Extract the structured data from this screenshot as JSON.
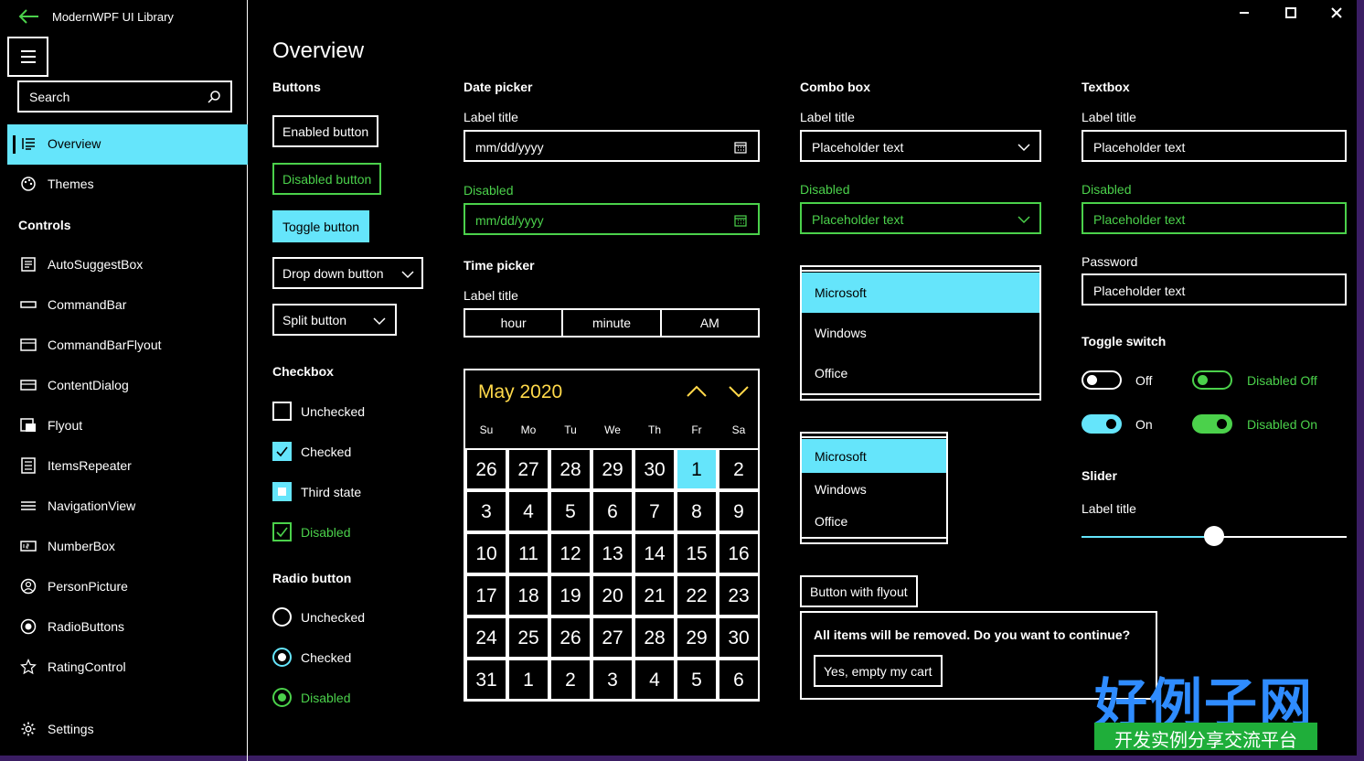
{
  "app": {
    "title": "ModernWPF UI Library"
  },
  "sidebar": {
    "search_placeholder": "Search",
    "items": [
      {
        "label": "Overview",
        "icon": "list-icon",
        "selected": true
      },
      {
        "label": "Themes",
        "icon": "palette-icon"
      }
    ],
    "controls_header": "Controls",
    "controls": [
      {
        "label": "AutoSuggestBox",
        "icon": "autosuggest-icon"
      },
      {
        "label": "CommandBar",
        "icon": "commandbar-icon"
      },
      {
        "label": "CommandBarFlyout",
        "icon": "commandbarflyout-icon"
      },
      {
        "label": "ContentDialog",
        "icon": "contentdialog-icon"
      },
      {
        "label": "Flyout",
        "icon": "flyout-icon"
      },
      {
        "label": "ItemsRepeater",
        "icon": "itemsrepeater-icon"
      },
      {
        "label": "NavigationView",
        "icon": "navigationview-icon"
      },
      {
        "label": "NumberBox",
        "icon": "numberbox-icon"
      },
      {
        "label": "PersonPicture",
        "icon": "personpicture-icon"
      },
      {
        "label": "RadioButtons",
        "icon": "radiobuttons-icon"
      },
      {
        "label": "RatingControl",
        "icon": "star-icon"
      }
    ],
    "settings_label": "Settings"
  },
  "page": {
    "title": "Overview"
  },
  "buttons": {
    "header": "Buttons",
    "enabled": "Enabled button",
    "disabled": "Disabled button",
    "toggle": "Toggle button",
    "dropdown": "Drop down button",
    "split": "Split button"
  },
  "checkbox": {
    "header": "Checkbox",
    "unchecked": "Unchecked",
    "checked": "Checked",
    "third": "Third state",
    "disabled": "Disabled"
  },
  "radio": {
    "header": "Radio button",
    "unchecked": "Unchecked",
    "checked": "Checked",
    "disabled": "Disabled"
  },
  "datepicker": {
    "header": "Date picker",
    "label": "Label title",
    "value": "mm/dd/yyyy",
    "disabled_label": "Disabled",
    "disabled_value": "mm/dd/yyyy"
  },
  "timepicker": {
    "header": "Time picker",
    "label": "Label title",
    "hour": "hour",
    "minute": "minute",
    "ampm": "AM"
  },
  "calendar": {
    "month": "May 2020",
    "dow": [
      "Su",
      "Mo",
      "Tu",
      "We",
      "Th",
      "Fr",
      "Sa"
    ],
    "days": [
      "26",
      "27",
      "28",
      "29",
      "30",
      "1",
      "2",
      "3",
      "4",
      "5",
      "6",
      "7",
      "8",
      "9",
      "10",
      "11",
      "12",
      "13",
      "14",
      "15",
      "16",
      "17",
      "18",
      "19",
      "20",
      "21",
      "22",
      "23",
      "24",
      "25",
      "26",
      "27",
      "28",
      "29",
      "30",
      "31",
      "1",
      "2",
      "3",
      "4",
      "5",
      "6"
    ],
    "today_index": 5
  },
  "combobox": {
    "header": "Combo box",
    "label": "Label title",
    "placeholder": "Placeholder text",
    "disabled_label": "Disabled",
    "disabled_placeholder": "Placeholder text",
    "list1": [
      "Microsoft",
      "Windows",
      "Office"
    ],
    "list2": [
      "Microsoft",
      "Windows",
      "Office"
    ]
  },
  "flyout": {
    "button": "Button with flyout",
    "message": "All items will be removed. Do you want to continue?",
    "confirm": "Yes, empty my cart"
  },
  "textbox": {
    "header": "Textbox",
    "label": "Label title",
    "placeholder": "Placeholder text",
    "disabled_label": "Disabled",
    "disabled_placeholder": "Placeholder text",
    "password_label": "Password",
    "password_placeholder": "Placeholder text"
  },
  "toggle": {
    "header": "Toggle switch",
    "off": "Off",
    "on": "On",
    "disabled_off": "Disabled Off",
    "disabled_on": "Disabled On"
  },
  "slider": {
    "header": "Slider",
    "label": "Label title",
    "value_fraction": 0.5
  },
  "watermark": {
    "line1": "好例子网",
    "line2": "开发实例分享交流平台"
  },
  "colors": {
    "accent": "#65e5fb",
    "disabled": "#4bd14b",
    "calendar_month": "#ffd94a"
  }
}
